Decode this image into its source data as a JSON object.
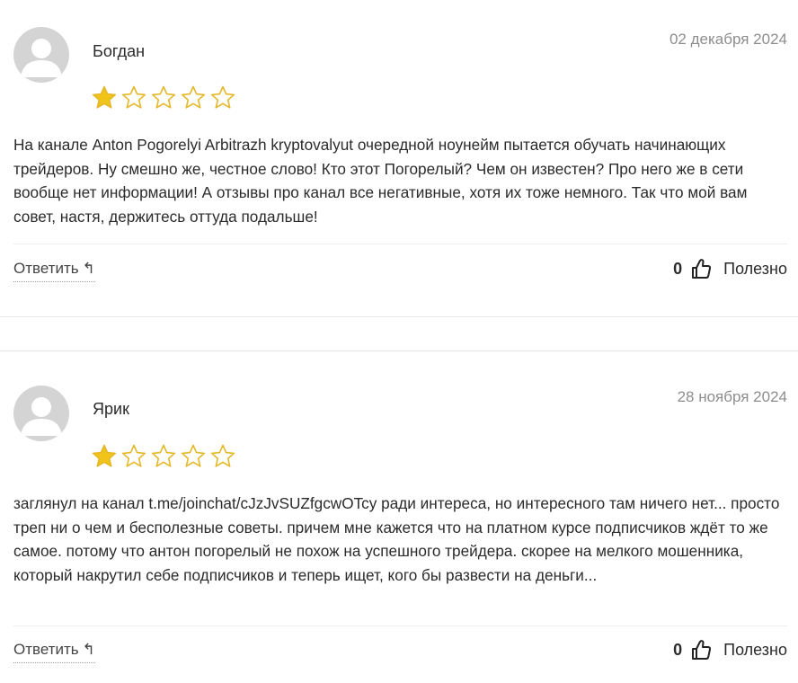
{
  "reviews": [
    {
      "author": "Богдан",
      "date": "02 декабря 2024",
      "rating": 1,
      "max_rating": 5,
      "text": "На канале Anton Pogorelyi Arbitrazh kryptovalyut очередной ноунейм пытается обучать начинающих трейдеров. Ну смешно же, честное слово! Кто этот Погорелый? Чем он известен? Про него же в сети вообще нет информации! А отзывы про канал все негативные, хотя их тоже немного. Так что мой вам совет, настя, держитесь оттуда подальше!",
      "reply_label": "Ответить",
      "reply_icon": "↰",
      "helpful_count": "0",
      "helpful_label": "Полезно"
    },
    {
      "author": "Ярик",
      "date": "28 ноября 2024",
      "rating": 1,
      "max_rating": 5,
      "text": "заглянул на канал t.me/joinchat/cJzJvSUZfgcwOTcy ради интереса, но интересного там ничего нет... просто треп ни о чем и бесполезные советы. причем мне кажется что на платном курсе подписчиков ждёт то же самое. потому что антон погорелый не похож на успешного трейдера. скорее на мелкого мошенника, который накрутил себе подписчиков и теперь ищет, кого бы развести на деньги...",
      "reply_label": "Ответить",
      "reply_icon": "↰",
      "helpful_count": "0",
      "helpful_label": "Полезно"
    }
  ],
  "colors": {
    "star_filled": "#f0c419",
    "star_outline": "#e5b82a",
    "avatar_bg": "#d4d4d4",
    "avatar_fg": "#ffffff",
    "date": "#8d8d8d"
  }
}
